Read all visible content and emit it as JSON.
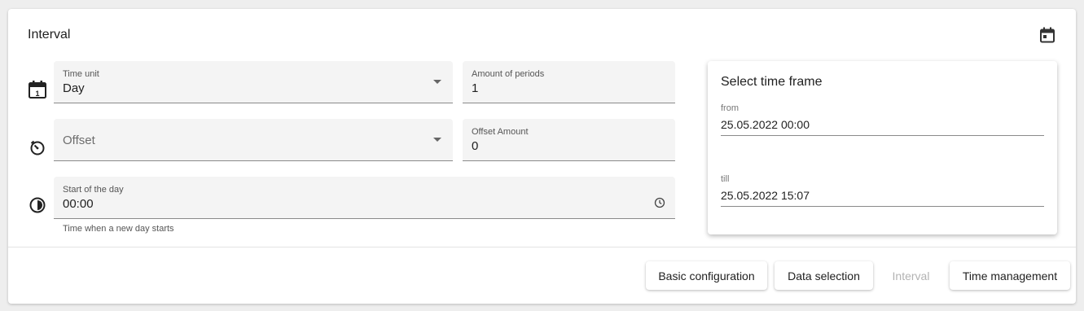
{
  "header": {
    "title": "Interval",
    "calendar_icon": "calendar-icon"
  },
  "fields": {
    "time_unit": {
      "label": "Time unit",
      "value": "Day"
    },
    "amount_of_periods": {
      "label": "Amount of periods",
      "value": "1"
    },
    "offset": {
      "placeholder": "Offset"
    },
    "offset_amount": {
      "label": "Offset Amount",
      "value": "0"
    },
    "start_of_day": {
      "label": "Start of the day",
      "value": "00:00",
      "hint": "Time when a new day starts"
    }
  },
  "row_icons": [
    "calendar-one-icon",
    "timer-offset-icon",
    "half-circle-icon"
  ],
  "time_frame": {
    "title": "Select time frame",
    "from_label": "from",
    "from_value": "25.05.2022 00:00",
    "till_label": "till",
    "till_value": "25.05.2022 15:07"
  },
  "nav": {
    "basic_configuration": "Basic configuration",
    "data_selection": "Data selection",
    "interval": "Interval",
    "time_management": "Time management"
  }
}
